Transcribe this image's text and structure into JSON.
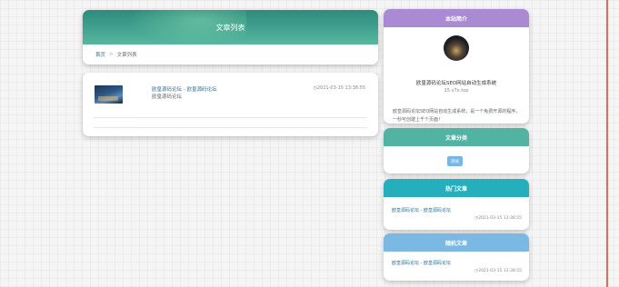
{
  "header": {
    "title": "文章列表",
    "breadcrumb": {
      "home": "首页",
      "separator": ">",
      "current": "文章列表"
    }
  },
  "articles": [
    {
      "title": "欧皇源码论坛 - 欧皇源码论坛",
      "excerpt": "欧皇源码论坛",
      "date": "2021-03-15 13:38:55"
    }
  ],
  "sidebar": {
    "intro": {
      "heading": "本站简介",
      "site_name": "欧皇源码论坛SEO网站自动生成系统",
      "site_url": "15.v7x.top",
      "description": "欧皇源码论坛SEO网站自动生成系统，是一个免费开源的程序，一秒可创建上千个页面！"
    },
    "categories": {
      "heading": "文章分类",
      "tags": [
        "测试"
      ]
    },
    "hot": {
      "heading": "热门文章",
      "items": [
        {
          "title": "欧皇源码论坛 - 欧皇源码论坛",
          "date": "2021-03-15 13:38:55"
        }
      ]
    },
    "random": {
      "heading": "随机文章",
      "items": [
        {
          "title": "欧皇源码论坛 - 欧皇源码论坛",
          "date": "2021-03-15 13:38:55"
        }
      ]
    }
  },
  "colors": {
    "intro_header": "#a98ad3",
    "category_header": "#52b3a2",
    "hot_header": "#25aebc",
    "random_header": "#7bb8e4",
    "banner": "#3f9e8c",
    "link": "#2a6f9e"
  }
}
